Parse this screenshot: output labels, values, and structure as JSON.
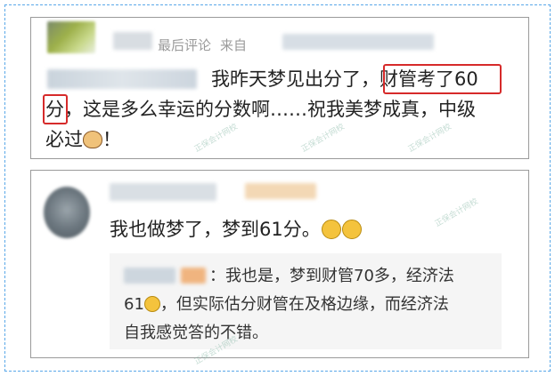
{
  "comment1": {
    "meta_tag": "最后评论",
    "meta_from": "来自",
    "text_line1": "我昨天梦见出分了，",
    "highlight1": "财管考了60",
    "highlight2": "分",
    "text_line2_rest": "，这是多么幸运的分数啊……祝我美梦成真，中级",
    "text_line3": "必过",
    "text_line3_end": "！"
  },
  "comment2": {
    "text": "我也做梦了，梦到61分。",
    "reply": {
      "line1": "：我也是，梦到财管70多，经济法",
      "line2_start": "61",
      "line2_end": "，但实际估分财管在及格边缘，而经济法",
      "line3": "自我感觉答的不错。"
    }
  },
  "colors": {
    "highlight_border": "#d62a2a",
    "frame_border": "#5aa8e8",
    "card_border": "#9a9a9a",
    "reply_bg": "#f5f5f5"
  },
  "icons": [
    "cat-emoji-icon",
    "crying-emoji-icon",
    "laughing-emoji-icon"
  ]
}
